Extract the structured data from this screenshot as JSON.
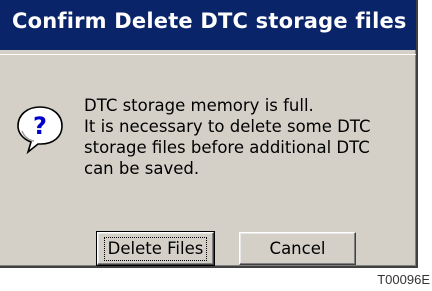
{
  "dialog": {
    "title": "Confirm Delete DTC storage files",
    "icon": "question-icon",
    "message_lines": [
      "DTC storage memory is full.",
      "It is necessary to delete some DTC",
      "storage files before additional DTC",
      "can be saved."
    ],
    "buttons": {
      "delete_label": "Delete Files",
      "cancel_label": "Cancel"
    }
  },
  "figure_code": "T00096E",
  "colors": {
    "titlebar": "#0a246a",
    "dialog_background": "#d4d0c8",
    "icon_bubble": "#ffffff",
    "icon_glyph": "#0000cc"
  }
}
